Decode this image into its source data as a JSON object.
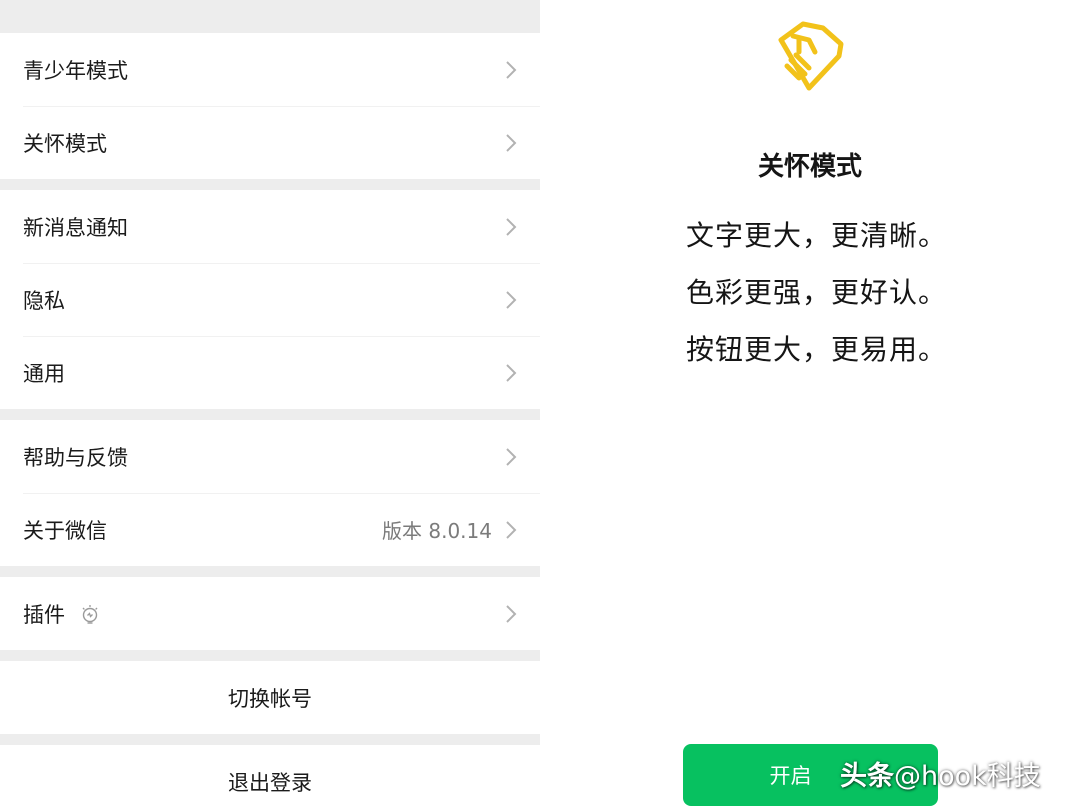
{
  "settings": {
    "groups": [
      {
        "items": [
          {
            "label": "青少年模式"
          },
          {
            "label": "关怀模式"
          }
        ]
      },
      {
        "items": [
          {
            "label": "新消息通知"
          },
          {
            "label": "隐私"
          },
          {
            "label": "通用"
          }
        ]
      },
      {
        "items": [
          {
            "label": "帮助与反馈"
          },
          {
            "label": "关于微信",
            "value": "版本 8.0.14"
          }
        ]
      },
      {
        "items": [
          {
            "label": "插件",
            "icon": "lightbulb-icon"
          }
        ]
      }
    ],
    "switch_account": "切换帐号",
    "logout": "退出登录"
  },
  "care_mode": {
    "logo_icon": "care-hands-heart-icon",
    "title": "关怀模式",
    "lines": [
      "文字更大，更清晰。",
      "色彩更强，更好认。",
      "按钮更大，更易用。"
    ],
    "enable_button": "开启",
    "watermark_brand": "头条",
    "watermark_handle": "@hook科技"
  },
  "colors": {
    "accent_green": "#07c160",
    "logo_yellow": "#f2c21a",
    "divider_gray": "#ededed",
    "secondary_text": "#7b7b7b"
  }
}
